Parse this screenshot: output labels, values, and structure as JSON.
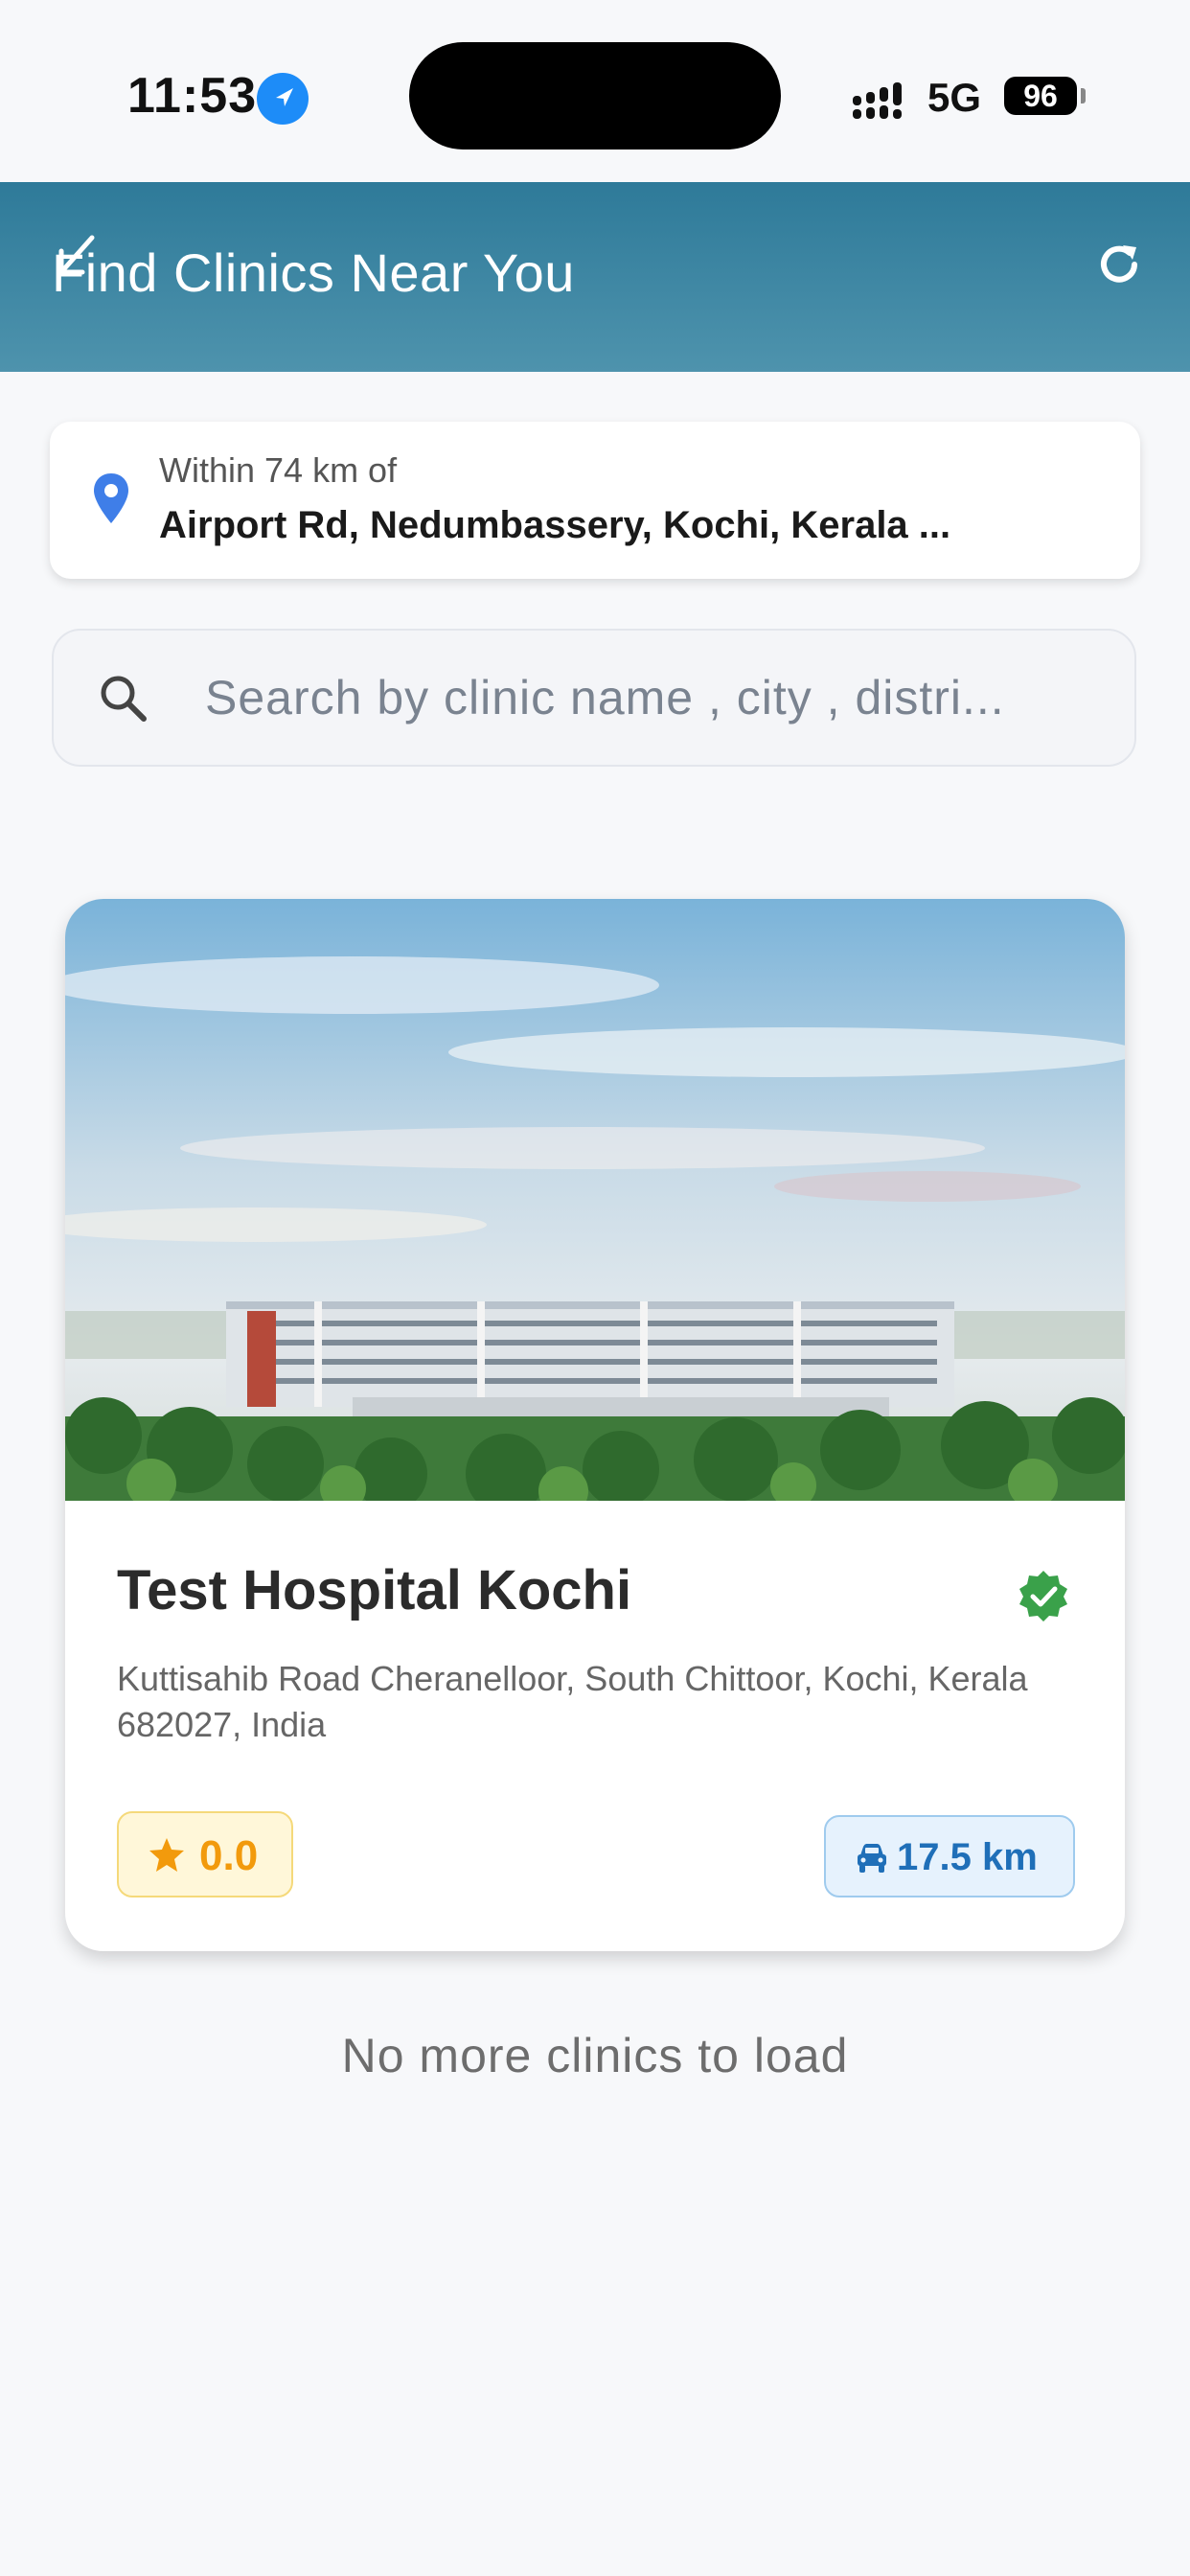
{
  "status_bar": {
    "time": "11:53",
    "network": "5G",
    "battery": "96"
  },
  "app_bar": {
    "title": "Find Clinics Near You"
  },
  "location": {
    "label": "Within 74 km of",
    "address": "Airport Rd, Nedumbassery, Kochi, Kerala ..."
  },
  "search": {
    "placeholder": "Search by clinic name , city , distri..."
  },
  "clinics": [
    {
      "name": "Test Hospital Kochi",
      "address": "Kuttisahib Road Cheranelloor, South Chittoor, Kochi, Kerala 682027, India",
      "rating": "0.0",
      "distance": "17.5 km",
      "verified": true
    }
  ],
  "footer": {
    "end_message": "No more clinics to load"
  },
  "colors": {
    "app_bar": "#2e7a99",
    "rating": "#f29a0c",
    "distance": "#1f6fb8",
    "verified": "#3aa14a"
  }
}
